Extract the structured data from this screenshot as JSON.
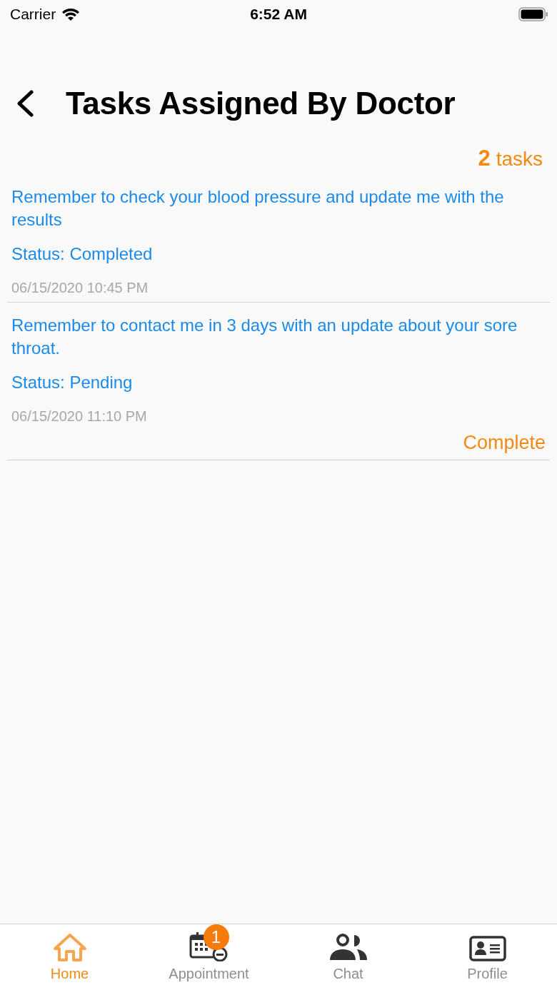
{
  "status_bar": {
    "carrier": "Carrier",
    "time": "6:52 AM"
  },
  "header": {
    "title": "Tasks Assigned By Doctor"
  },
  "task_count": "**2** tasks",
  "tasks": [
    {
      "text": "Remember to check your blood pressure and update me with the results",
      "status": "Status: Completed",
      "date": "06/15/2020 10:45 PM"
    },
    {
      "text": "Remember to contact me in 3 days with an update about your sore throat.",
      "status": "Status: Pending",
      "date": "06/15/2020 11:10 PM",
      "action": "Complete"
    }
  ],
  "tab_bar": [
    {
      "kind": "home",
      "label": "Home",
      "selected": true
    },
    {
      "kind": "calendar",
      "label": "Appointment",
      "selected": false,
      "badge": "1"
    },
    {
      "kind": "people",
      "label": "Chat",
      "selected": false
    },
    {
      "kind": "card",
      "label": "Profile",
      "selected": false
    }
  ]
}
